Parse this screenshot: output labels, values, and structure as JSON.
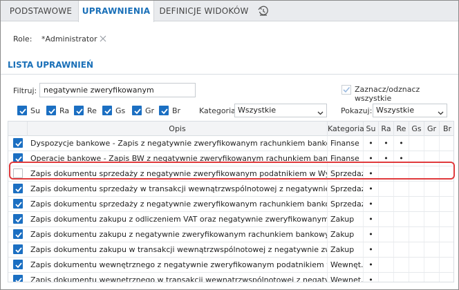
{
  "tabs": [
    {
      "label": "PODSTAWOWE",
      "active": false
    },
    {
      "label": "UPRAWNIENIA",
      "active": true
    },
    {
      "label": "DEFINICJE WIDOKÓW",
      "active": false
    }
  ],
  "role": {
    "label": "Role:",
    "value": "*Administrator"
  },
  "section_title": "LISTA UPRAWNIEŃ",
  "filter": {
    "label": "Filtruj:",
    "value": "negatywnie zweryfikowanym"
  },
  "select_all_label": "Zaznacz/odznacz wszystkie",
  "flags": [
    {
      "label": "Su",
      "checked": true
    },
    {
      "label": "Ra",
      "checked": true
    },
    {
      "label": "Re",
      "checked": true
    },
    {
      "label": "Gs",
      "checked": true
    },
    {
      "label": "Gr",
      "checked": true
    },
    {
      "label": "Br",
      "checked": true
    }
  ],
  "category_filter": {
    "label": "Kategoria:",
    "value": "Wszystkie"
  },
  "show_filter": {
    "label": "Pokazuj:",
    "value": "Wszystkie"
  },
  "columns": [
    "Opis",
    "Kategoria",
    "Su",
    "Ra",
    "Re",
    "Gs",
    "Gr",
    "Br"
  ],
  "rows": [
    {
      "checked": true,
      "opis": "Dyspozycje bankowe - Zapis z negatywnie zweryfikowanym rachunkiem bankowym w...",
      "kategoria": "Finanse",
      "su": "•",
      "ra": "•",
      "re": "•",
      "gs": "",
      "gr": "",
      "br": ""
    },
    {
      "checked": true,
      "opis": "Operacje bankowe - Zapis BW z negatywnie zweryfikowanym rachunkiem bankowym...",
      "kategoria": "Finanse",
      "su": "•",
      "ra": "•",
      "re": "•",
      "gs": "",
      "gr": "",
      "br": ""
    },
    {
      "checked": false,
      "opis": "Zapis dokumentu sprzedaży z negatywnie zweryfikowanym podatnikiem w Wykazie p...",
      "kategoria": "Sprzedaż",
      "su": "•",
      "ra": "",
      "re": "",
      "gs": "",
      "gr": "",
      "br": ""
    },
    {
      "checked": true,
      "opis": "Zapis dokumentu sprzedaży w transakcji wewnątrzwspólnotowej z negatywnie zweryfi...",
      "kategoria": "Sprzedaż",
      "su": "•",
      "ra": "",
      "re": "",
      "gs": "",
      "gr": "",
      "br": ""
    },
    {
      "checked": true,
      "opis": "Zapis dokumentu sprzedaży z negatywnie zweryfikowanym rachunkiem bankowym n...",
      "kategoria": "Sprzedaż",
      "su": "•",
      "ra": "",
      "re": "",
      "gs": "",
      "gr": "",
      "br": ""
    },
    {
      "checked": true,
      "opis": "Zapis dokumentu zakupu z odliczeniem VAT oraz negatywnie zweryfikowanym podat...",
      "kategoria": "Zakup",
      "su": "•",
      "ra": "",
      "re": "",
      "gs": "",
      "gr": "",
      "br": ""
    },
    {
      "checked": true,
      "opis": "Zapis dokumentu zakupu z negatywnie zweryfikowanym rachunkiem bankowym w W...",
      "kategoria": "Zakup",
      "su": "•",
      "ra": "",
      "re": "",
      "gs": "",
      "gr": "",
      "br": ""
    },
    {
      "checked": true,
      "opis": "Zapis dokumentu zakupu w transakcji wewnątrzwspólnotowej z negatywnie zweryfiko...",
      "kategoria": "Zakup",
      "su": "•",
      "ra": "",
      "re": "",
      "gs": "",
      "gr": "",
      "br": ""
    },
    {
      "checked": true,
      "opis": "Zapis dokumentu wewnętrznego z negatywnie zweryfikowanym podatnikiem w Wyka...",
      "kategoria": "Wewnęt...",
      "su": "•",
      "ra": "",
      "re": "",
      "gs": "",
      "gr": "",
      "br": ""
    },
    {
      "checked": true,
      "opis": "Zapis dokumentu wewnętrznego w transakcji wewnątrzwspólnotowej z negatywnie z...",
      "kategoria": "Wewnęt...",
      "su": "•",
      "ra": "",
      "re": "",
      "gs": "",
      "gr": "",
      "br": ""
    }
  ],
  "colors": {
    "accent": "#1a70b8",
    "checkbox": "#1b6fc2",
    "highlight": "#e0393b"
  }
}
